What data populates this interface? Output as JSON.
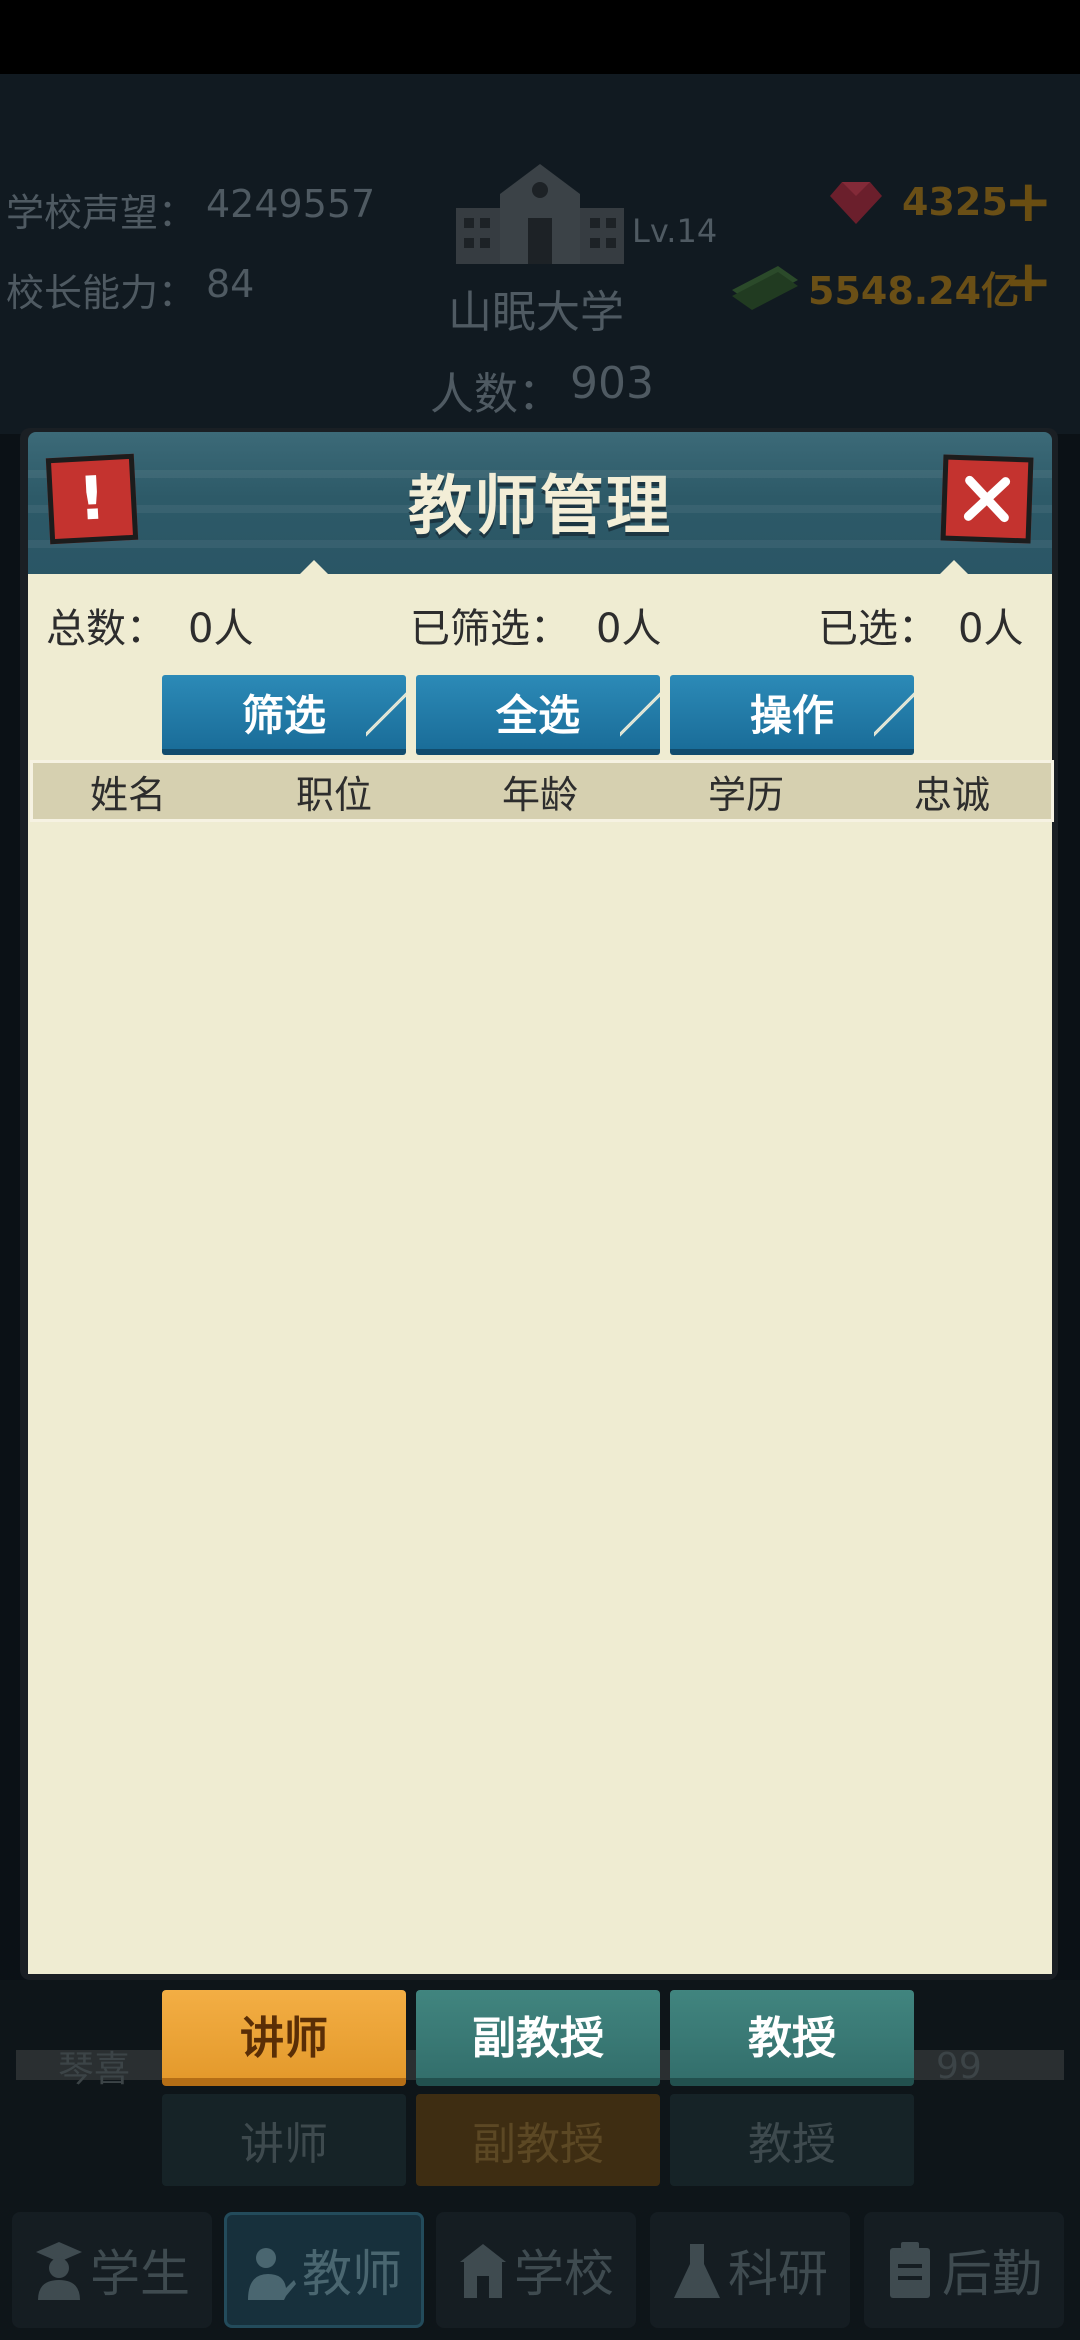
{
  "hud": {
    "reputation_label": "学校声望：",
    "reputation_value": "4249557",
    "ability_label": "校长能力：",
    "ability_value": "84",
    "level": "Lv.14",
    "school_name": "山眠大学",
    "population_label": "人数：",
    "population_value": "903",
    "gems": "4325",
    "money": "5548.24亿"
  },
  "modal": {
    "title": "教师管理",
    "alert_glyph": "!",
    "total_label": "总数：",
    "total_value": "0人",
    "filtered_label": "已筛选：",
    "filtered_value": "0人",
    "selected_label": "已选：",
    "selected_value": "0人",
    "buttons": {
      "filter": "筛选",
      "select_all": "全选",
      "actions": "操作"
    },
    "columns": [
      "姓名",
      "职位",
      "年龄",
      "学历",
      "忠诚"
    ]
  },
  "rank_tabs": [
    {
      "label": "讲师",
      "state": "active"
    },
    {
      "label": "副教授",
      "state": "inactive"
    },
    {
      "label": "教授",
      "state": "inactive"
    }
  ],
  "rank_tabs_background": [
    "讲师",
    "副教授",
    "教授"
  ],
  "background_row": {
    "name_fragment": "琴喜",
    "value": "99"
  },
  "nav": [
    {
      "label": "学生",
      "icon": "student-icon",
      "active": false
    },
    {
      "label": "教师",
      "icon": "teacher-icon",
      "active": true
    },
    {
      "label": "学校",
      "icon": "school-icon",
      "active": false
    },
    {
      "label": "科研",
      "icon": "flask-icon",
      "active": false
    },
    {
      "label": "后勤",
      "icon": "clipboard-icon",
      "active": false
    }
  ],
  "colors": {
    "header_teal": "#2d5a68",
    "button_blue": "#1a6d99",
    "tab_orange": "#f0a83a",
    "tab_teal": "#3a7a7e",
    "close_red": "#c4332f",
    "panel_cream": "#efecd2"
  }
}
